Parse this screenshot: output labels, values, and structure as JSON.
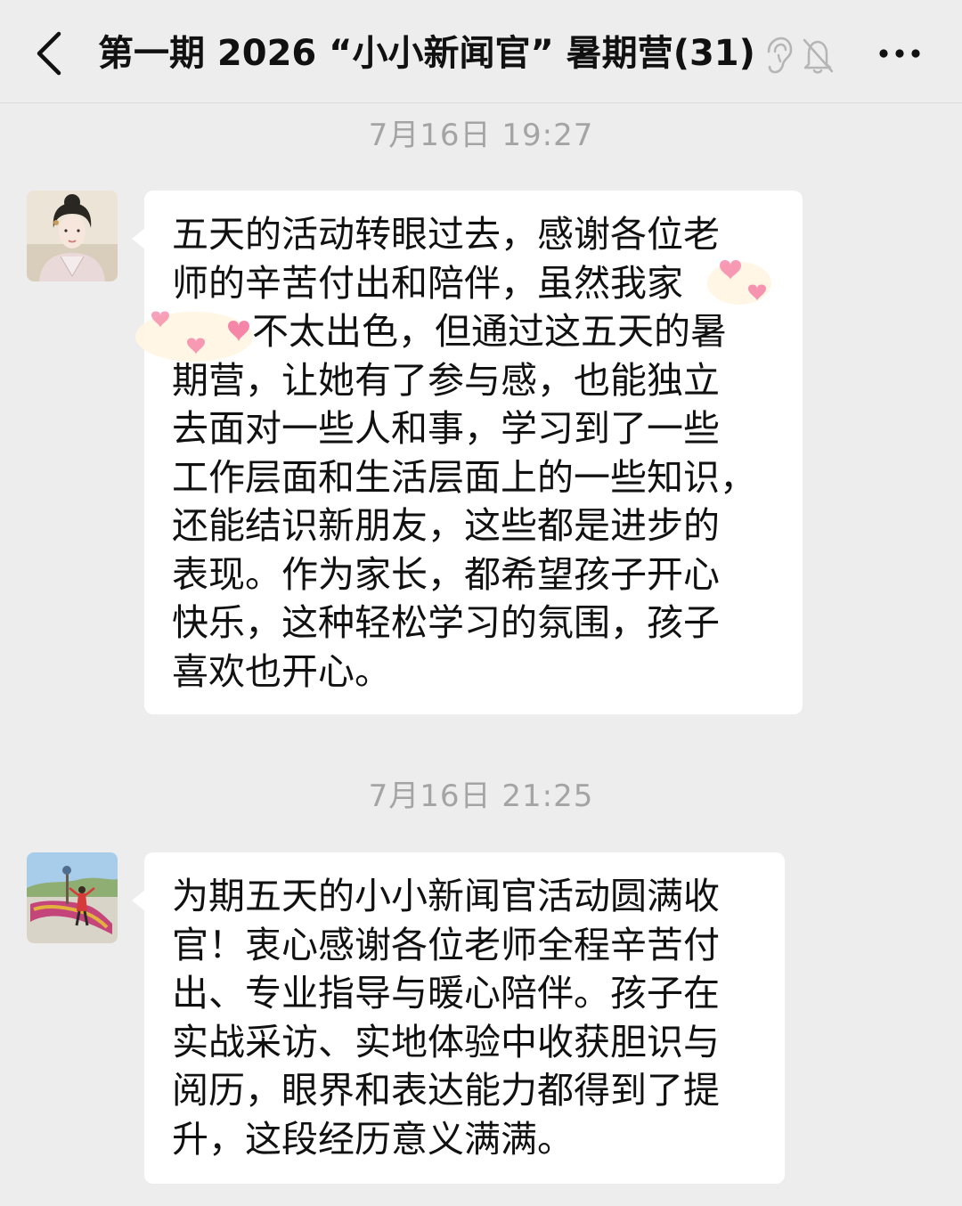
{
  "header": {
    "back_icon": "chevron-left-icon",
    "title": "第一期 2026 “小小新闻官” 暑期营",
    "member_count": "(31)",
    "ear_icon": "ear-icon",
    "mute_icon": "bell-off-icon",
    "more_icon": "more-dots-icon"
  },
  "messages": [
    {
      "timestamp": "7月16日 19:27",
      "avatar": "avatar-woman-hanfu",
      "lines": [
        "五天的活动转眼过去，感谢各位老",
        "师的辛苦付出和陪伴，虽然我家",
        "不太出色，但通过这五天的暑",
        "期营，让她有了参与感，也能独立",
        "去面对一些人和事，学习到了一些",
        "工作层面和生活层面上的一些知识，",
        "还能结识新朋友，这些都是进步的",
        "表现。作为家长，都希望孩子开心",
        "快乐，这种轻松学习的氛围，孩子",
        "喜欢也开心。"
      ]
    },
    {
      "timestamp": "7月16日 21:25",
      "avatar": "avatar-outdoor-flowers",
      "lines": [
        "为期五天的小小新闻官活动圆满收",
        "官！衷心感谢各位老师全程辛苦付",
        "出、专业指导与暖心陪伴。孩子在",
        "实战采访、实地体验中收获胆识与",
        "阅历，眼界和表达能力都得到了提",
        "升，这段经历意义满满。"
      ]
    }
  ],
  "colors": {
    "background": "#ededed",
    "bubble": "#ffffff",
    "timestamp": "#a4a4a4",
    "text": "#111111",
    "sticker_pink": "#f47aa0"
  }
}
